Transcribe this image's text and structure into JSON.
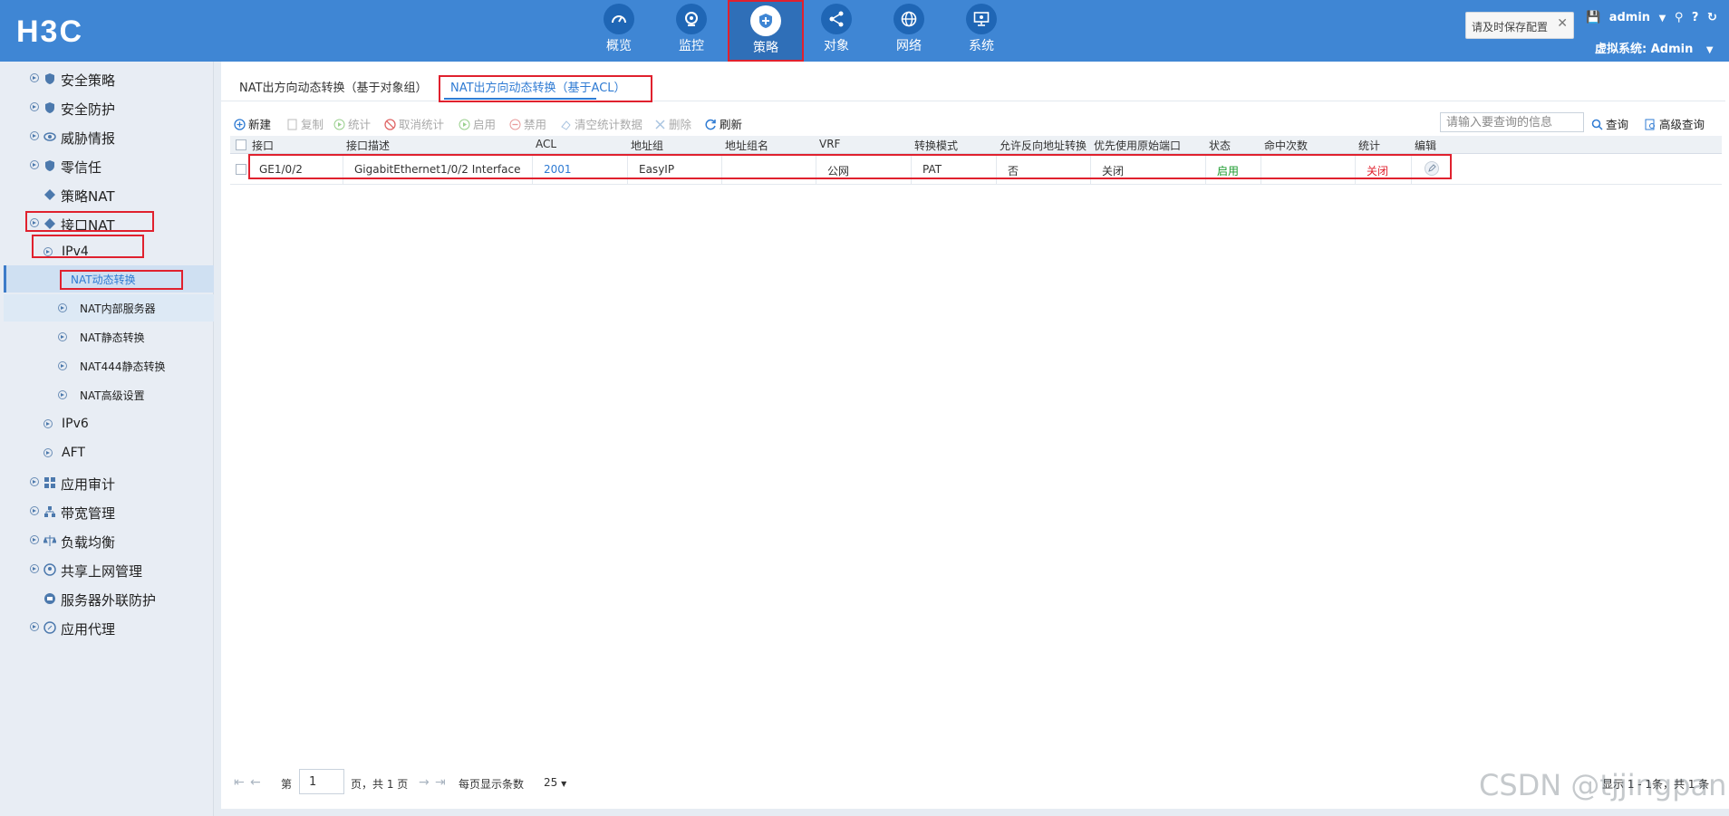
{
  "header": {
    "logo": "H3C",
    "nav": [
      {
        "label": "概览",
        "icon": "gauge-icon"
      },
      {
        "label": "监控",
        "icon": "webcam-icon"
      },
      {
        "label": "策略",
        "icon": "shield-icon",
        "active": true
      },
      {
        "label": "对象",
        "icon": "share-icon"
      },
      {
        "label": "网络",
        "icon": "globe-icon"
      },
      {
        "label": "系统",
        "icon": "monitor-icon"
      }
    ],
    "save_tip": "请及时保存配置",
    "user": "admin",
    "vsys_label": "虚拟系统: Admin"
  },
  "sidebar": {
    "items": [
      {
        "label": "安全策略"
      },
      {
        "label": "安全防护"
      },
      {
        "label": "威胁情报"
      },
      {
        "label": "零信任"
      },
      {
        "label": "策略NAT"
      },
      {
        "label": "接口NAT"
      },
      {
        "label": "IPv4"
      },
      {
        "label": "NAT动态转换"
      },
      {
        "label": "NAT内部服务器"
      },
      {
        "label": "NAT静态转换"
      },
      {
        "label": "NAT444静态转换"
      },
      {
        "label": "NAT高级设置"
      },
      {
        "label": "IPv6"
      },
      {
        "label": "AFT"
      },
      {
        "label": "应用审计"
      },
      {
        "label": "带宽管理"
      },
      {
        "label": "负载均衡"
      },
      {
        "label": "共享上网管理"
      },
      {
        "label": "服务器外联防护"
      },
      {
        "label": "应用代理"
      }
    ]
  },
  "main": {
    "tabs": [
      {
        "label": "NAT出方向动态转换（基于对象组）"
      },
      {
        "label": "NAT出方向动态转换（基于ACL）",
        "active": true
      }
    ],
    "toolbar": {
      "new": "新建",
      "copy": "复制",
      "stats": "统计",
      "cancel_stats": "取消统计",
      "enable": "启用",
      "disable": "禁用",
      "clear_stats": "清空统计数据",
      "delete": "删除",
      "refresh": "刷新",
      "search_placeholder": "请输入要查询的信息",
      "search": "查询",
      "advanced": "高级查询"
    },
    "table": {
      "columns": [
        "接口",
        "接口描述",
        "ACL",
        "地址组",
        "地址组名",
        "VRF",
        "转换模式",
        "允许反向地址转换",
        "优先使用原始端口",
        "状态",
        "命中次数",
        "统计",
        "编辑"
      ],
      "rows": [
        {
          "interface": "GE1/0/2",
          "desc": "GigabitEthernet1/0/2 Interface",
          "acl": "2001",
          "addr_group": "EasyIP",
          "addr_group_name": "",
          "vrf": "公网",
          "mode": "PAT",
          "reverse": "否",
          "orig_port": "关闭",
          "status": "启用",
          "hits": "",
          "stats": "关闭"
        }
      ]
    },
    "pager": {
      "page_prefix": "第",
      "page": "1",
      "page_suffix": "页，共 1 页",
      "per_page_label": "每页显示条数",
      "per_page": "25",
      "summary": "显示 1 - 1条，共 1 条"
    }
  },
  "colors": {
    "header": "#3f86d4",
    "accent": "#2f7bd3",
    "highlight": "#e0212e",
    "enabled": "#1a9a2c"
  },
  "watermark": "CSDN @tjjingpan"
}
